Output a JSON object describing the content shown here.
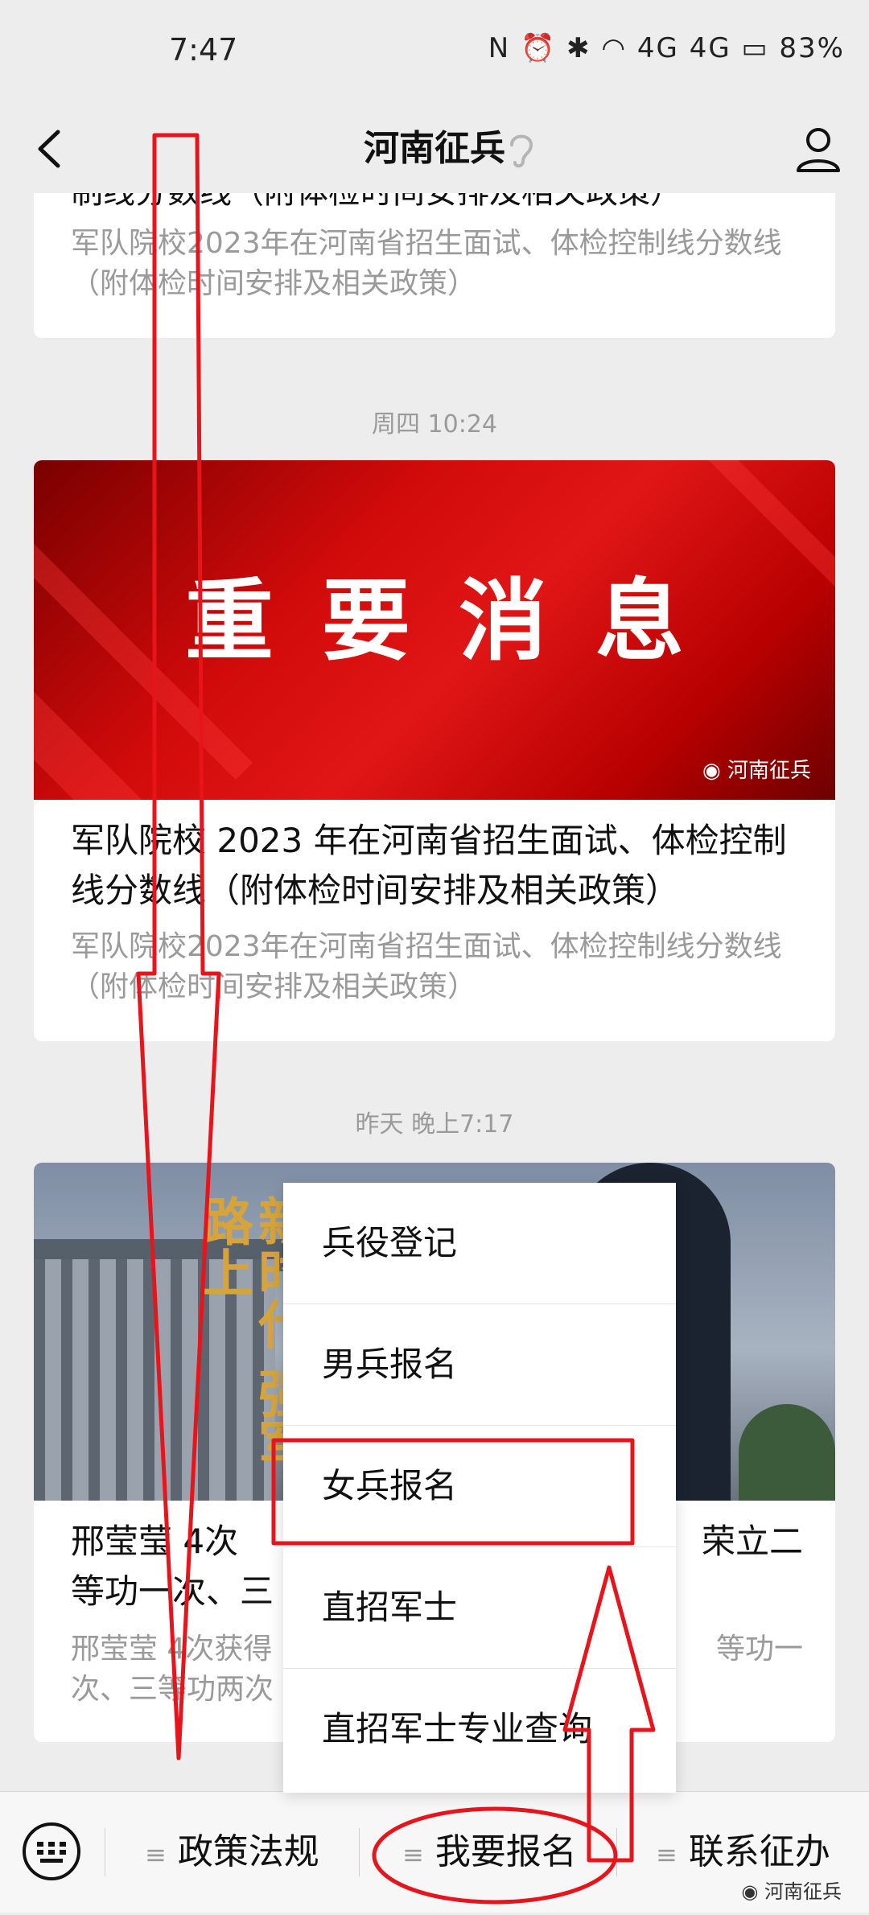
{
  "status": {
    "time": "7:47",
    "battery": "83%",
    "signal_label": "4G 4G"
  },
  "navbar": {
    "title": "河南征兵"
  },
  "messages": [
    {
      "title_partial": "制线分数线（附体检时间安排及相关政策）",
      "description": "军队院校2023年在河南省招生面试、体检控制线分数线（附体检时间安排及相关政策）"
    },
    {
      "timestamp": "周四 10:24",
      "banner_text": "重要消息",
      "watermark": "河南征兵",
      "title": "军队院校 2023 年在河南省招生面试、体检控制线分数线（附体检时间安排及相关政策）",
      "description": "军队院校2023年在河南省招生面试、体检控制线分数线（附体检时间安排及相关政策）"
    },
    {
      "timestamp": "昨天 晚上7:17",
      "image_text": "新时代 强军路上",
      "title_left": "邢莹莹 4次",
      "title_right": "荣立二",
      "title_line2": "等功一次、三",
      "desc_left": "邢莹莹 4次获得",
      "desc_right": "等功一",
      "desc_line2": "次、三等功两次"
    }
  ],
  "popup_menu": {
    "items": [
      "兵役登记",
      "男兵报名",
      "女兵报名",
      "直招军士",
      "直招军士专业查询"
    ]
  },
  "tabbar": {
    "tabs": [
      "政策法规",
      "我要报名",
      "联系征办"
    ],
    "watermark": "河南征兵"
  },
  "annotation_color": "#e8141b"
}
